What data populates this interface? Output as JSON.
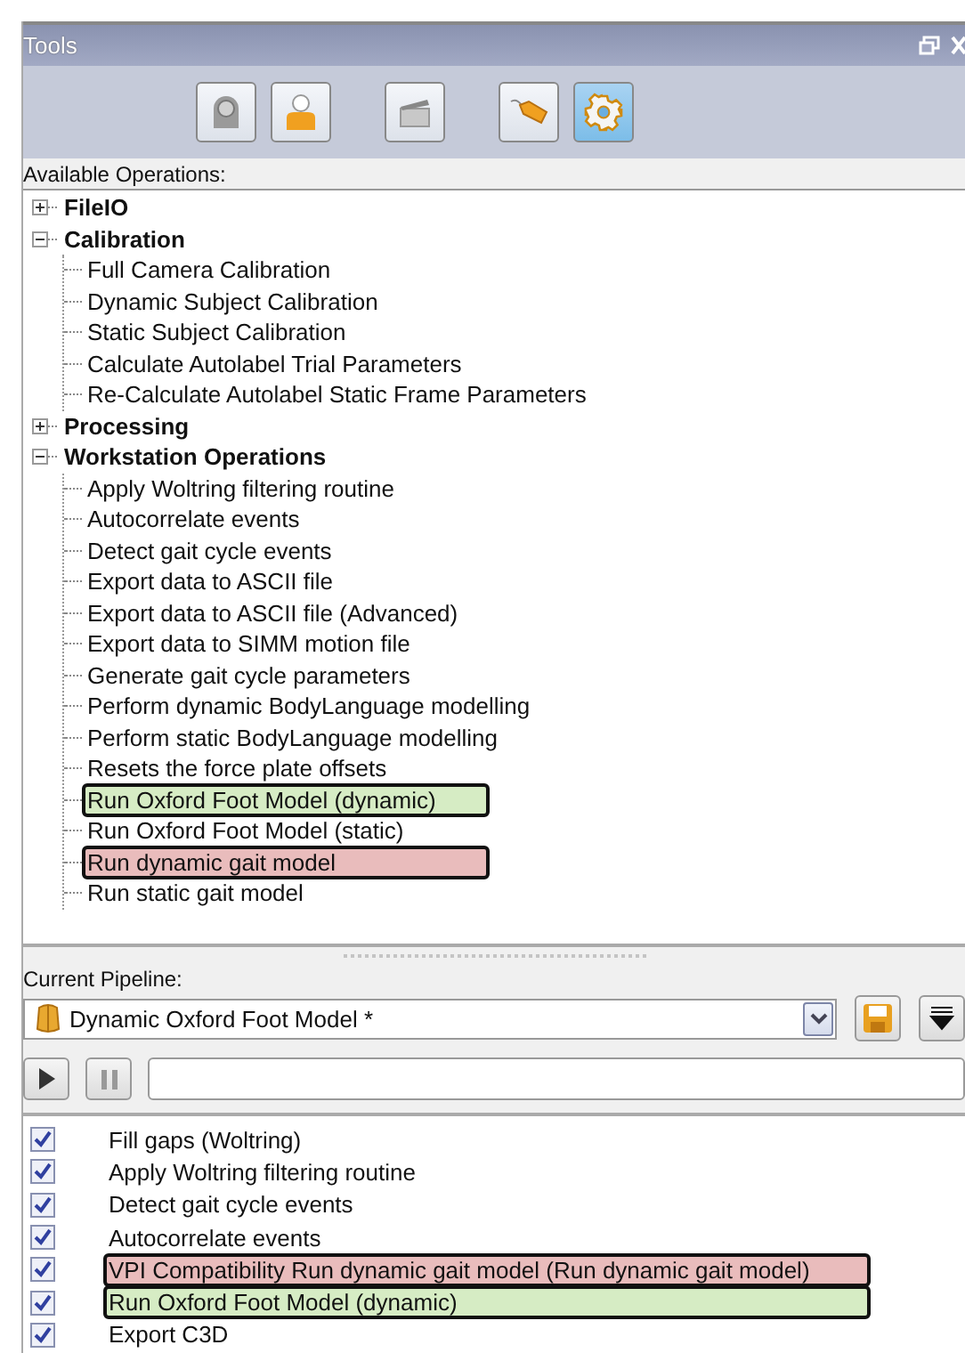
{
  "panel": {
    "title": "Tools"
  },
  "toolbar": [
    {
      "kind": "camera",
      "selected": false
    },
    {
      "kind": "person",
      "selected": false
    },
    {
      "kind": "clapper",
      "selected": false
    },
    {
      "kind": "tag",
      "selected": false
    },
    {
      "kind": "gear",
      "selected": true
    }
  ],
  "operations": {
    "label": "Available Operations:",
    "tree": [
      {
        "label": "FileIO",
        "expanded": false
      },
      {
        "label": "Calibration",
        "expanded": true,
        "children": [
          {
            "label": "Full Camera Calibration"
          },
          {
            "label": "Dynamic Subject Calibration"
          },
          {
            "label": "Static Subject Calibration"
          },
          {
            "label": "Calculate Autolabel Trial Parameters"
          },
          {
            "label": "Re-Calculate Autolabel Static Frame Parameters"
          }
        ]
      },
      {
        "label": "Processing",
        "expanded": false
      },
      {
        "label": "Workstation Operations",
        "expanded": true,
        "children": [
          {
            "label": "Apply Woltring filtering routine"
          },
          {
            "label": "Autocorrelate events"
          },
          {
            "label": "Detect gait cycle events"
          },
          {
            "label": "Export data to ASCII file"
          },
          {
            "label": "Export data to ASCII file (Advanced)"
          },
          {
            "label": "Export data to SIMM motion file"
          },
          {
            "label": "Generate gait cycle parameters"
          },
          {
            "label": "Perform dynamic BodyLanguage modelling"
          },
          {
            "label": "Perform static BodyLanguage modelling"
          },
          {
            "label": "Resets the force plate offsets"
          },
          {
            "label": "Run Oxford Foot Model (dynamic)",
            "color": "#d6ecc4"
          },
          {
            "label": "Run Oxford Foot Model (static)"
          },
          {
            "label": "Run dynamic gait model",
            "color": "#e9bcbc"
          },
          {
            "label": "Run static gait model"
          }
        ]
      }
    ]
  },
  "pipeline": {
    "label": "Current Pipeline:",
    "value": "Dynamic Oxford Foot Model *",
    "steps": [
      {
        "label": "Fill gaps (Woltring)",
        "checked": true
      },
      {
        "label": "Apply Woltring filtering routine",
        "checked": true
      },
      {
        "label": "Detect gait cycle events",
        "checked": true
      },
      {
        "label": "Autocorrelate events",
        "checked": true
      },
      {
        "label": "VPI Compatibility Run dynamic gait model (Run dynamic gait model)",
        "checked": true,
        "color": "#e9bcbc"
      },
      {
        "label": "Run Oxford Foot Model (dynamic)",
        "checked": true,
        "color": "#d6ecc4"
      },
      {
        "label": "Export C3D",
        "checked": true
      }
    ]
  }
}
